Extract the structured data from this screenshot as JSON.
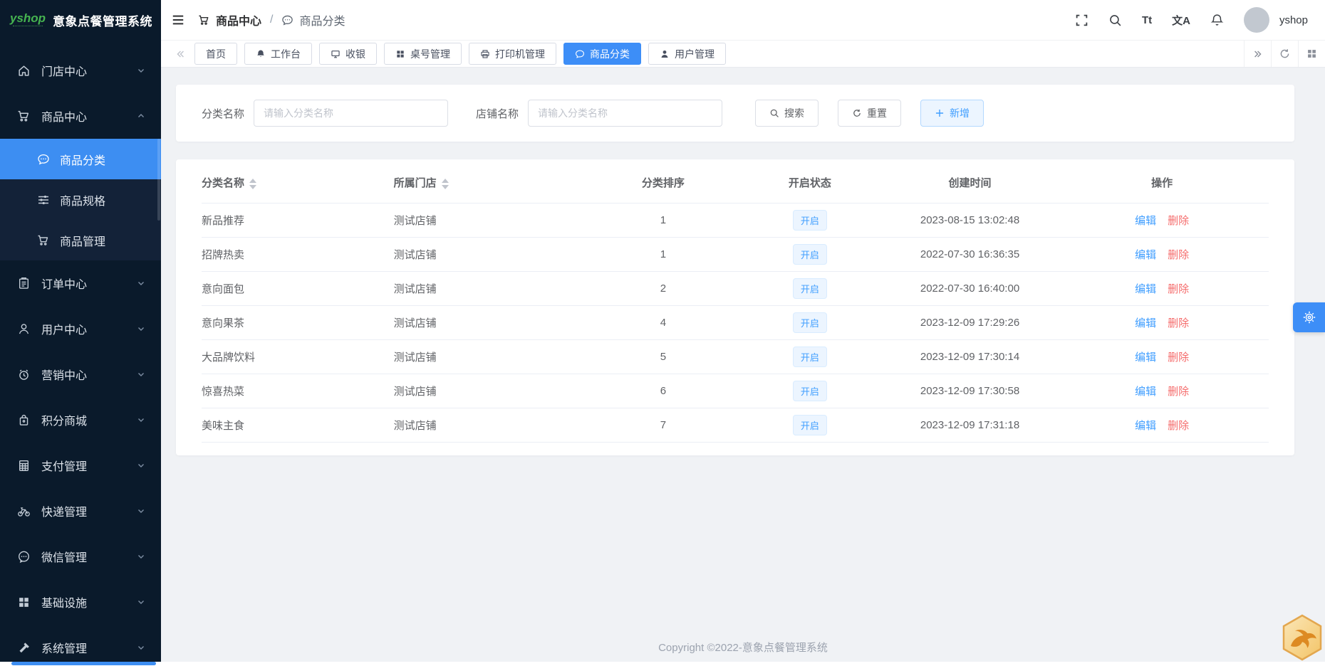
{
  "colors": {
    "primary": "#409eff",
    "danger": "#f56c6c",
    "sidebar_bg": "#0a1a2b",
    "active_menu": "#3d8ef2",
    "badge_bg": "#ecf5ff"
  },
  "brand": {
    "logo": "yshop",
    "title": "意象点餐管理系统"
  },
  "sidebar": {
    "items": [
      {
        "label": "门店中心",
        "icon": "home-icon"
      },
      {
        "label": "商品中心",
        "icon": "cart-icon"
      },
      {
        "label": "订单中心",
        "icon": "order-icon"
      },
      {
        "label": "用户中心",
        "icon": "user-icon"
      },
      {
        "label": "营销中心",
        "icon": "alarm-icon"
      },
      {
        "label": "积分商城",
        "icon": "bag-icon"
      },
      {
        "label": "支付管理",
        "icon": "calculator-icon"
      },
      {
        "label": "快递管理",
        "icon": "bike-icon"
      },
      {
        "label": "微信管理",
        "icon": "chat-icon"
      },
      {
        "label": "基础设施",
        "icon": "grid-icon"
      },
      {
        "label": "系统管理",
        "icon": "hammer-icon"
      }
    ],
    "submenu": [
      {
        "label": "商品分类",
        "icon": "comment-icon",
        "active": true
      },
      {
        "label": "商品规格",
        "icon": "sliders-icon"
      },
      {
        "label": "商品管理",
        "icon": "cart-icon"
      }
    ]
  },
  "topbar": {
    "breadcrumb": [
      {
        "label": "商品中心",
        "icon": "cart-icon"
      },
      {
        "label": "商品分类",
        "icon": "comment-icon"
      }
    ],
    "separator": "/",
    "font_size_button": "Tt",
    "translate_button": "文A",
    "username": "yshop"
  },
  "tabs": {
    "items": [
      {
        "label": "首页"
      },
      {
        "label": "工作台",
        "icon": "bell-icon"
      },
      {
        "label": "收银",
        "icon": "monitor-icon"
      },
      {
        "label": "桌号管理",
        "icon": "grid-icon"
      },
      {
        "label": "打印机管理",
        "icon": "printer-icon"
      },
      {
        "label": "商品分类",
        "icon": "comment-icon",
        "active": true
      },
      {
        "label": "用户管理",
        "icon": "user-icon"
      }
    ]
  },
  "filters": {
    "category_label": "分类名称",
    "category_placeholder": "请输入分类名称",
    "category_value": "",
    "store_label": "店铺名称",
    "store_placeholder": "请输入分类名称",
    "store_value": "",
    "search_button": "搜索",
    "reset_button": "重置",
    "add_button": "新增"
  },
  "table": {
    "columns": [
      "分类名称",
      "所属门店",
      "分类排序",
      "开启状态",
      "创建时间",
      "操作"
    ],
    "rows": [
      {
        "name": "新品推荐",
        "store": "测试店铺",
        "sort": "1",
        "status": "开启",
        "created": "2023-08-15 13:02:48"
      },
      {
        "name": "招牌热卖",
        "store": "测试店铺",
        "sort": "1",
        "status": "开启",
        "created": "2022-07-30 16:36:35"
      },
      {
        "name": "意向面包",
        "store": "测试店铺",
        "sort": "2",
        "status": "开启",
        "created": "2022-07-30 16:40:00"
      },
      {
        "name": "意向果茶",
        "store": "测试店铺",
        "sort": "4",
        "status": "开启",
        "created": "2023-12-09 17:29:26"
      },
      {
        "name": "大品牌饮料",
        "store": "测试店铺",
        "sort": "5",
        "status": "开启",
        "created": "2023-12-09 17:30:14"
      },
      {
        "name": "惊喜热菜",
        "store": "测试店铺",
        "sort": "6",
        "status": "开启",
        "created": "2023-12-09 17:30:58"
      },
      {
        "name": "美味主食",
        "store": "测试店铺",
        "sort": "7",
        "status": "开启",
        "created": "2023-12-09 17:31:18"
      }
    ],
    "actions": {
      "edit": "编辑",
      "delete": "删除"
    }
  },
  "footer": {
    "copyright": "Copyright ©2022-意象点餐管理系统"
  }
}
